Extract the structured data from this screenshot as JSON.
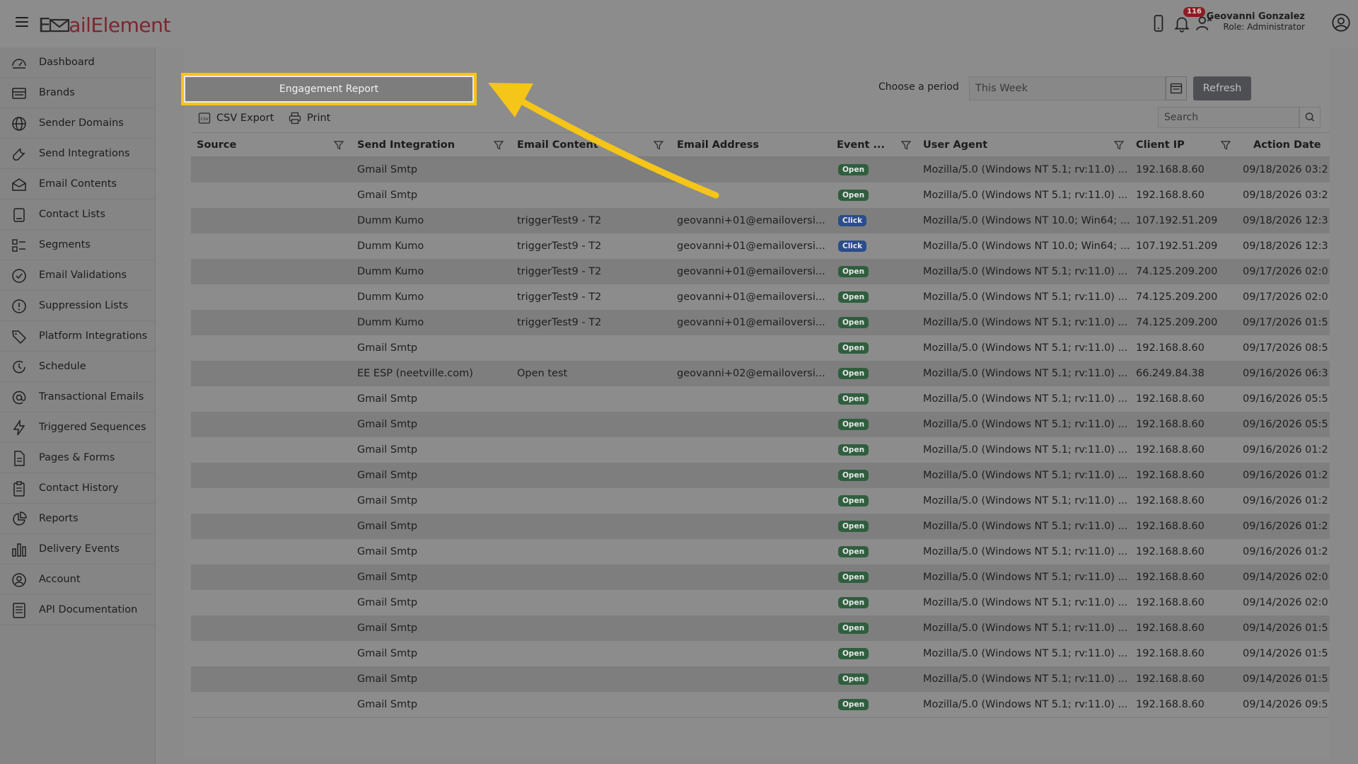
{
  "header": {
    "logo_part1": "E",
    "logo_part2": "ailElement",
    "notifications_count": "116",
    "user_name": "Geovanni Gonzalez",
    "user_role": "Role: Administrator"
  },
  "sidebar": {
    "items": [
      {
        "label": "Dashboard",
        "icon": "dashboard-icon"
      },
      {
        "label": "Brands",
        "icon": "brands-icon"
      },
      {
        "label": "Sender Domains",
        "icon": "globe-icon"
      },
      {
        "label": "Send Integrations",
        "icon": "wrench-icon"
      },
      {
        "label": "Email Contents",
        "icon": "envelope-icon"
      },
      {
        "label": "Contact Lists",
        "icon": "contact-list-icon"
      },
      {
        "label": "Segments",
        "icon": "segments-icon"
      },
      {
        "label": "Email Validations",
        "icon": "check-circle-icon"
      },
      {
        "label": "Suppression Lists",
        "icon": "exclamation-circle-icon"
      },
      {
        "label": "Platform Integrations",
        "icon": "tag-icon"
      },
      {
        "label": "Schedule",
        "icon": "clock-icon"
      },
      {
        "label": "Transactional Emails",
        "icon": "at-sign-icon"
      },
      {
        "label": "Triggered Sequences",
        "icon": "lightning-icon"
      },
      {
        "label": "Pages & Forms",
        "icon": "page-icon"
      },
      {
        "label": "Contact History",
        "icon": "clipboard-icon"
      },
      {
        "label": "Reports",
        "icon": "pie-chart-icon"
      },
      {
        "label": "Delivery Events",
        "icon": "bar-chart-icon"
      },
      {
        "label": "Account",
        "icon": "user-circle-icon"
      },
      {
        "label": "API Documentation",
        "icon": "document-icon"
      }
    ]
  },
  "report": {
    "button_label": "Engagement Report",
    "period_label": "Choose a period",
    "period_value": "This Week",
    "refresh_label": "Refresh"
  },
  "toolbar": {
    "csv_export_label": "CSV Export",
    "print_label": "Print",
    "search_placeholder": "Search"
  },
  "table": {
    "columns": [
      "Source",
      "Send Integration",
      "Email Content",
      "Email Address",
      "Event ...",
      "User Agent",
      "Client IP",
      "Action Date"
    ],
    "rows": [
      [
        "",
        "Gmail Smtp",
        "",
        "",
        "Open",
        "Mozilla/5.0 (Windows NT 5.1; rv:11.0) ...",
        "192.168.8.60",
        "09/18/2026 03:2"
      ],
      [
        "",
        "Gmail Smtp",
        "",
        "",
        "Open",
        "Mozilla/5.0 (Windows NT 5.1; rv:11.0) ...",
        "192.168.8.60",
        "09/18/2026 03:2"
      ],
      [
        "",
        "Dumm Kumo",
        "triggerTest9 - T2",
        "geovanni+01@emailoversi...",
        "Click",
        "Mozilla/5.0 (Windows NT 10.0; Win64; ...",
        "107.192.51.209",
        "09/18/2026 12:3"
      ],
      [
        "",
        "Dumm Kumo",
        "triggerTest9 - T2",
        "geovanni+01@emailoversi...",
        "Click",
        "Mozilla/5.0 (Windows NT 10.0; Win64; ...",
        "107.192.51.209",
        "09/18/2026 12:3"
      ],
      [
        "",
        "Dumm Kumo",
        "triggerTest9 - T2",
        "geovanni+01@emailoversi...",
        "Open",
        "Mozilla/5.0 (Windows NT 5.1; rv:11.0) ...",
        "74.125.209.200",
        "09/17/2026 02:0"
      ],
      [
        "",
        "Dumm Kumo",
        "triggerTest9 - T2",
        "geovanni+01@emailoversi...",
        "Open",
        "Mozilla/5.0 (Windows NT 5.1; rv:11.0) ...",
        "74.125.209.200",
        "09/17/2026 02:0"
      ],
      [
        "",
        "Dumm Kumo",
        "triggerTest9 - T2",
        "geovanni+01@emailoversi...",
        "Open",
        "Mozilla/5.0 (Windows NT 5.1; rv:11.0) ...",
        "74.125.209.200",
        "09/17/2026 01:5"
      ],
      [
        "",
        "Gmail Smtp",
        "",
        "",
        "Open",
        "Mozilla/5.0 (Windows NT 5.1; rv:11.0) ...",
        "192.168.8.60",
        "09/17/2026 08:5"
      ],
      [
        "",
        "EE ESP (neetville.com)",
        "Open test",
        "geovanni+02@emailoversi...",
        "Open",
        "Mozilla/5.0 (Windows NT 5.1; rv:11.0) ...",
        "66.249.84.38",
        "09/16/2026 06:3"
      ],
      [
        "",
        "Gmail Smtp",
        "",
        "",
        "Open",
        "Mozilla/5.0 (Windows NT 5.1; rv:11.0) ...",
        "192.168.8.60",
        "09/16/2026 05:5"
      ],
      [
        "",
        "Gmail Smtp",
        "",
        "",
        "Open",
        "Mozilla/5.0 (Windows NT 5.1; rv:11.0) ...",
        "192.168.8.60",
        "09/16/2026 05:5"
      ],
      [
        "",
        "Gmail Smtp",
        "",
        "",
        "Open",
        "Mozilla/5.0 (Windows NT 5.1; rv:11.0) ...",
        "192.168.8.60",
        "09/16/2026 01:2"
      ],
      [
        "",
        "Gmail Smtp",
        "",
        "",
        "Open",
        "Mozilla/5.0 (Windows NT 5.1; rv:11.0) ...",
        "192.168.8.60",
        "09/16/2026 01:2"
      ],
      [
        "",
        "Gmail Smtp",
        "",
        "",
        "Open",
        "Mozilla/5.0 (Windows NT 5.1; rv:11.0) ...",
        "192.168.8.60",
        "09/16/2026 01:2"
      ],
      [
        "",
        "Gmail Smtp",
        "",
        "",
        "Open",
        "Mozilla/5.0 (Windows NT 5.1; rv:11.0) ...",
        "192.168.8.60",
        "09/16/2026 01:2"
      ],
      [
        "",
        "Gmail Smtp",
        "",
        "",
        "Open",
        "Mozilla/5.0 (Windows NT 5.1; rv:11.0) ...",
        "192.168.8.60",
        "09/16/2026 01:2"
      ],
      [
        "",
        "Gmail Smtp",
        "",
        "",
        "Open",
        "Mozilla/5.0 (Windows NT 5.1; rv:11.0) ...",
        "192.168.8.60",
        "09/14/2026 02:0"
      ],
      [
        "",
        "Gmail Smtp",
        "",
        "",
        "Open",
        "Mozilla/5.0 (Windows NT 5.1; rv:11.0) ...",
        "192.168.8.60",
        "09/14/2026 02:0"
      ],
      [
        "",
        "Gmail Smtp",
        "",
        "",
        "Open",
        "Mozilla/5.0 (Windows NT 5.1; rv:11.0) ...",
        "192.168.8.60",
        "09/14/2026 01:5"
      ],
      [
        "",
        "Gmail Smtp",
        "",
        "",
        "Open",
        "Mozilla/5.0 (Windows NT 5.1; rv:11.0) ...",
        "192.168.8.60",
        "09/14/2026 01:5"
      ],
      [
        "",
        "Gmail Smtp",
        "",
        "",
        "Open",
        "Mozilla/5.0 (Windows NT 5.1; rv:11.0) ...",
        "192.168.8.60",
        "09/14/2026 01:5"
      ],
      [
        "",
        "Gmail Smtp",
        "",
        "",
        "Open",
        "Mozilla/5.0 (Windows NT 5.1; rv:11.0) ...",
        "192.168.8.60",
        "09/14/2026 09:5"
      ]
    ]
  },
  "colors": {
    "highlight": "#f5c518",
    "open_badge": "#2f5e3e",
    "click_badge": "#2a4d8a",
    "notification_badge": "#8b1c22"
  }
}
